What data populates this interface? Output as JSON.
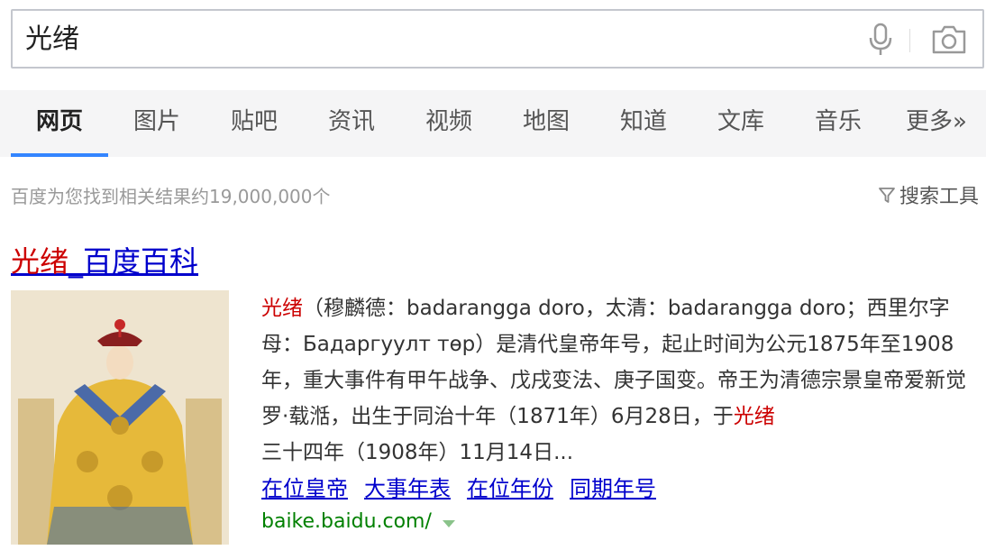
{
  "search": {
    "query": "光绪"
  },
  "tabs": [
    "网页",
    "图片",
    "贴吧",
    "资讯",
    "视频",
    "地图",
    "知道",
    "文库",
    "音乐",
    "更多»"
  ],
  "meta": {
    "result_count": "百度为您找到相关结果约19,000,000个",
    "tools_label": "搜索工具"
  },
  "result": {
    "title_highlight": "光绪",
    "title_rest": "_百度百科",
    "snippet_hl_1": "光绪",
    "snippet_body": "（穆麟德：badarangga doro，太清：badarangga doro；西里尔字母：Бадаргуулт төр）是清代皇帝年号，起止时间为公元1875年至1908年，重大事件有甲午战争、戊戌变法、庚子国变。帝王为清德宗景皇帝爱新觉罗·载湉，出生于同治十年（1871年）6月28日，于",
    "snippet_hl_2": "光绪",
    "snippet_tail": "三十四年（1908年）11月14日...",
    "sublinks": [
      "在位皇帝",
      "大事年表",
      "在位年份",
      "同期年号"
    ],
    "url": "baike.baidu.com/"
  },
  "colors": {
    "link": "#0000cc",
    "highlight": "#cc0000",
    "url_green": "#008000",
    "tab_active": "#3385ff"
  },
  "icons": [
    "microphone-icon",
    "camera-icon",
    "funnel-icon",
    "dropdown-caret-icon"
  ]
}
